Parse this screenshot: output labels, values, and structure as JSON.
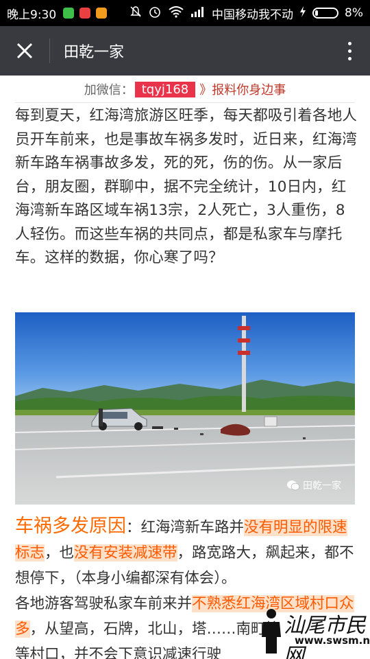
{
  "status_bar": {
    "time": "晚上9:30",
    "carrier": "中国移动我不动",
    "battery": "8%",
    "icons": [
      "app-green-icon",
      "app-play-icon",
      "app-orange-icon",
      "mute-icon",
      "alarm-icon",
      "wifi-icon",
      "signal-icon",
      "charging-icon",
      "battery-icon"
    ]
  },
  "topbar": {
    "title": "田乾一家"
  },
  "promo": {
    "prefix": "加微信：",
    "wechat_id": "tqyj168",
    "arrow": "》",
    "report": "报料你身边事"
  },
  "article": {
    "paragraph": "每到夏天，红海湾旅游区旺季，每天都吸引着各地人员开车前来，也是事故车祸多发时，近日来，红海湾新车路车祸事故多发，死的死，伤的伤。从一家后台，朋友圈，群聊中，据不完全统计，10日内，红海湾新车路区域车祸13宗，2人死亡，3人重伤，8人轻伤。而这些车祸的共同点，都是私家车与摩托车。这样的数据，你心寒了吗？"
  },
  "photo": {
    "watermark": "田乾一家"
  },
  "section2": {
    "heading": "车祸多发原因",
    "colon": "：",
    "t1": "红海湾新车路并",
    "h1": "没有明显的限速标志",
    "t2": "，也",
    "h2": "没有安装减速带",
    "t3": "，路宽路大，飙起来，都不想停下，（本身小编都深有体会）。",
    "t4": "各地游客驾驶私家车前来并",
    "h3": "不熟悉红海湾区域村口众多",
    "t5": "，从望高，石牌，北山，塔",
    "t6": "……南町等",
    "t7": "等村口，并不会下意识减速行驶"
  },
  "corner_logo": {
    "text": "汕尾市民网",
    "url": "www.swsm.net"
  },
  "colors": {
    "status_bar": "#000000",
    "topbar": "#393a3f",
    "promo_highlight": "#e8334a",
    "heading": "#ff6a00",
    "highlight_bg": "#ffe0c8"
  }
}
